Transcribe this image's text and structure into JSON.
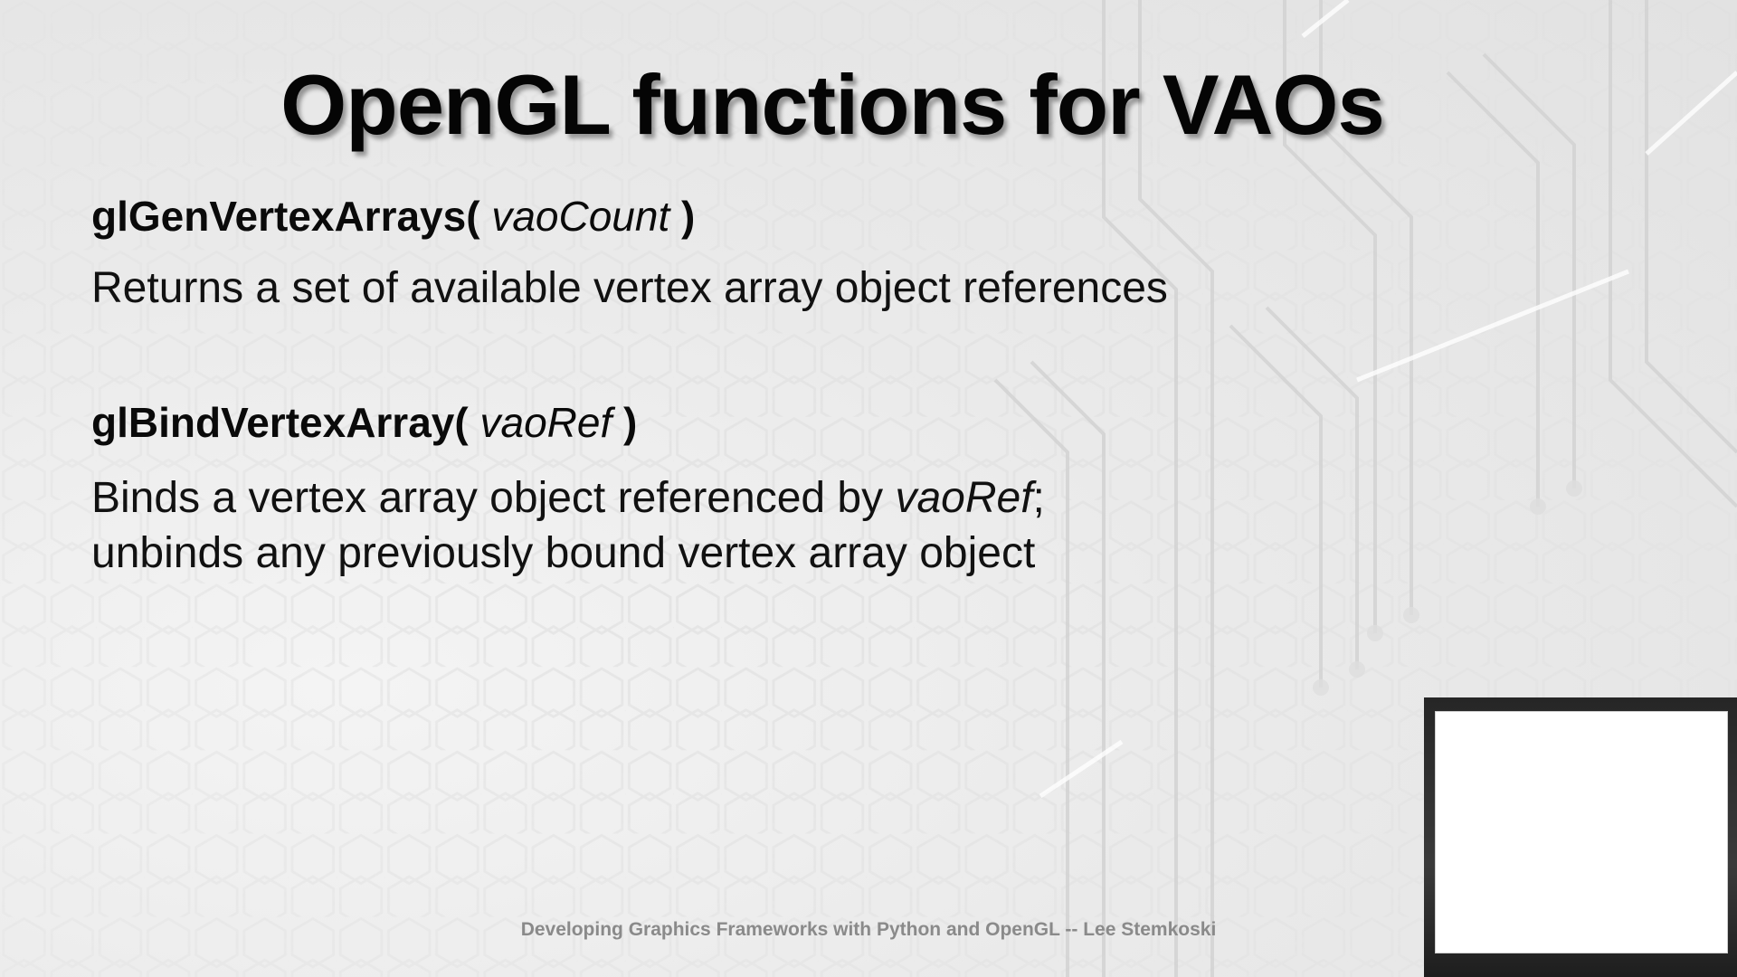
{
  "slide": {
    "title": "OpenGL functions for VAOs",
    "functions": [
      {
        "signature_name": "glGenVertexArrays(",
        "signature_param": "vaoCount",
        "signature_close": ")",
        "description_line1": "Returns a set of available vertex array object references"
      },
      {
        "signature_name": "glBindVertexArray(",
        "signature_param": "vaoRef",
        "signature_close": ")",
        "description_line1_pre": "Binds a vertex array object referenced by ",
        "description_line1_param": "vaoRef",
        "description_line1_post": ";",
        "description_line2": "unbinds any previously bound vertex array object"
      }
    ],
    "footer": "Developing Graphics Frameworks with Python and OpenGL -- Lee Stemkoski"
  },
  "colors": {
    "background": "#ececec",
    "text": "#111111",
    "footer": "#8a8a8a",
    "webcam_frame": "#2a2a2a",
    "webcam_screen": "#ffffff"
  }
}
